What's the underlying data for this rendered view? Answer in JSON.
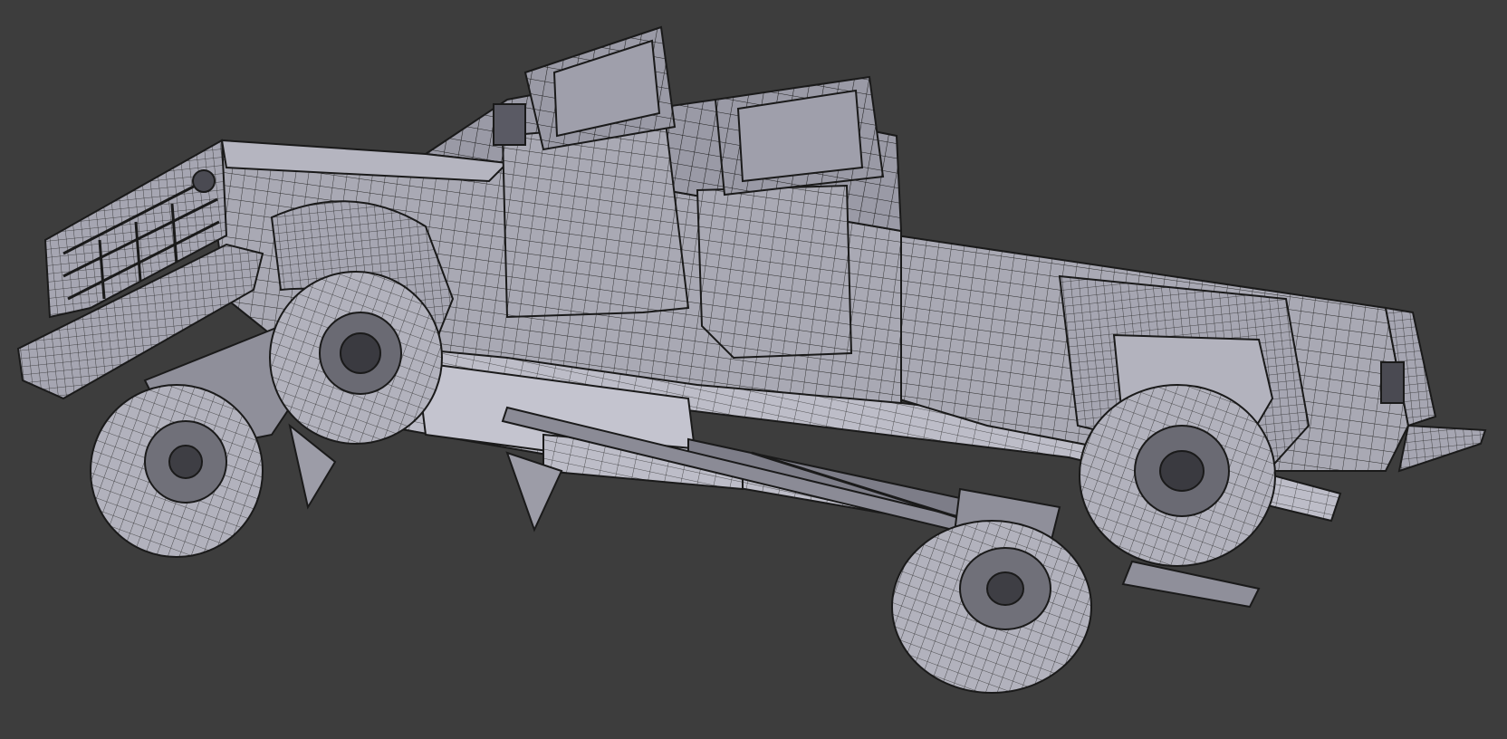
{
  "viewport": {
    "background": "#3d3d3d",
    "mesh_color": "#a9a9b4",
    "wire_color": "#1a1a1a",
    "view_mode": "wireframe"
  },
  "model": {
    "subject": "pickup-truck",
    "doors_open": 2,
    "wheels": 4
  }
}
